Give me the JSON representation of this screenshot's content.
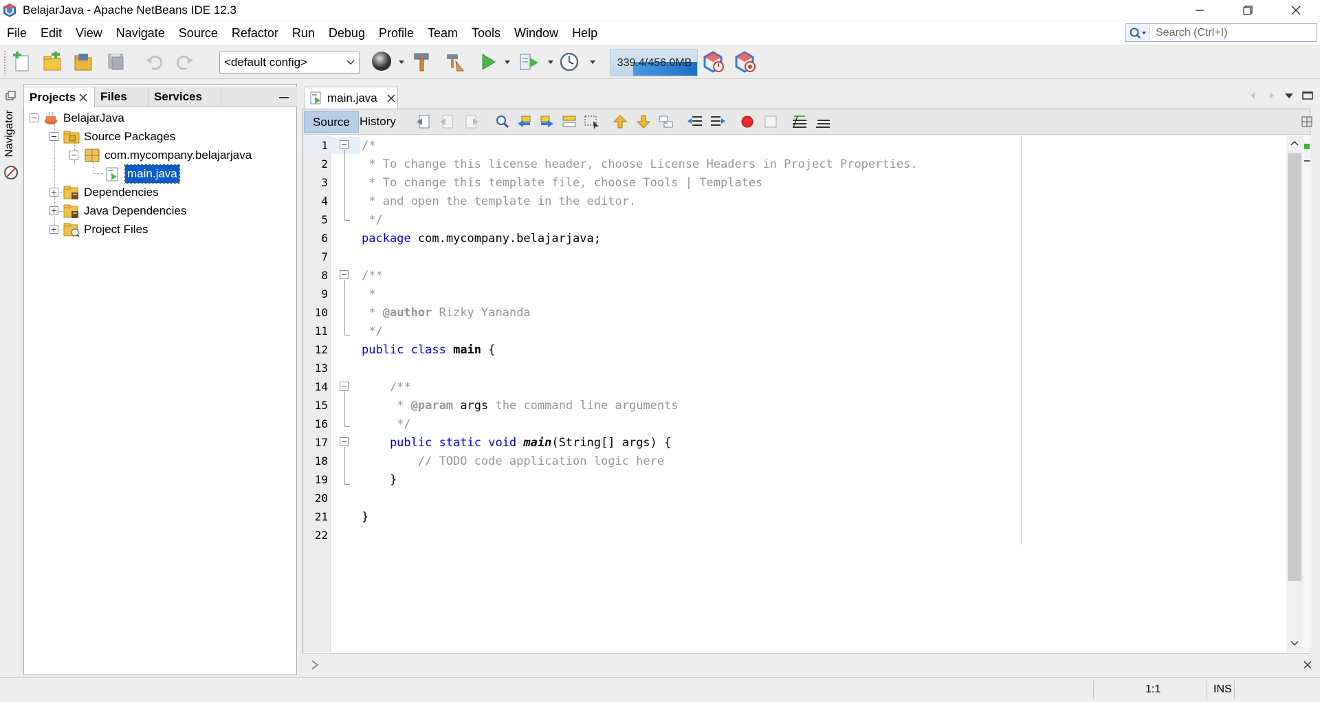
{
  "window": {
    "title": "BelajarJava - Apache NetBeans IDE 12.3",
    "controls": [
      "minimize",
      "restore",
      "close"
    ]
  },
  "menu": [
    "File",
    "Edit",
    "View",
    "Navigate",
    "Source",
    "Refactor",
    "Run",
    "Debug",
    "Profile",
    "Team",
    "Tools",
    "Window",
    "Help"
  ],
  "search": {
    "placeholder": "Search (Ctrl+I)"
  },
  "toolbar": {
    "config": "<default config>",
    "memory": "339.4/456.0MB",
    "memory_fraction": 0.744
  },
  "side": {
    "navigator_label": "Navigator"
  },
  "panel": {
    "tabs": [
      "Projects",
      "Files",
      "Services"
    ],
    "active_tab": "Projects",
    "tree": {
      "project": "BelajarJava",
      "source_packages": "Source Packages",
      "package": "com.mycompany.belajarjava",
      "file": "main.java",
      "dependencies": "Dependencies",
      "java_dependencies": "Java Dependencies",
      "project_files": "Project Files"
    }
  },
  "editor": {
    "tab_label": "main.java",
    "view_tabs": [
      "Source",
      "History"
    ],
    "active_view": "Source",
    "line_numbers": [
      "1",
      "2",
      "3",
      "4",
      "5",
      "6",
      "7",
      "8",
      "9",
      "10",
      "11",
      "12",
      "13",
      "14",
      "15",
      "16",
      "17",
      "18",
      "19",
      "20",
      "21",
      "22"
    ],
    "code": {
      "l1": "/*",
      "l2": " * To change this license header, choose License Headers in Project Properties.",
      "l3": " * To change this template file, choose Tools | Templates",
      "l4": " * and open the template in the editor.",
      "l5": " */",
      "l6_kw": "package",
      "l6_rest": " com.mycompany.belajarjava;",
      "l8": "/**",
      "l9": " *",
      "l10_pre": " * ",
      "l10_tag": "@author",
      "l10_rest": " Rizky Yananda",
      "l11": " */",
      "l12_kw": "public class",
      "l12_name": "main",
      "l12_rest": " {",
      "l14": "    /**",
      "l15_pre": "     * ",
      "l15_tag": "@param",
      "l15_arg": " args",
      "l15_rest": " the command line arguments",
      "l16": "     */",
      "l17_kw": "    public static void",
      "l17_name": "main",
      "l17_rest": "(String[] args) {",
      "l18": "        // TODO code application logic here",
      "l19": "    }",
      "l21": "}"
    }
  },
  "status": {
    "position": "1:1",
    "mode": "INS"
  },
  "colors": {
    "keyword": "#0000e6",
    "comment": "#969696",
    "selection": "#0a5bc4",
    "memory_bar": "#2c80d3"
  }
}
